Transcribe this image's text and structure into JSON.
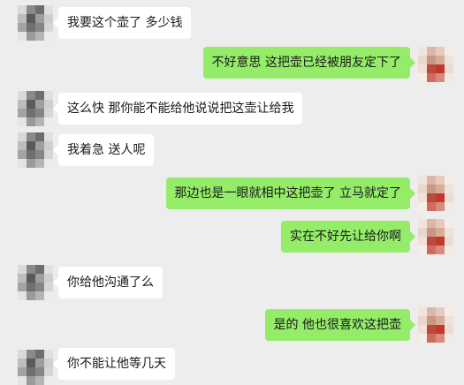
{
  "colors": {
    "background": "#ededed",
    "bubble_self": "#95ec69",
    "bubble_other": "#ffffff",
    "text": "#191919"
  },
  "messages": [
    {
      "side": "left",
      "text": "我要这个壶了 多少钱"
    },
    {
      "side": "right",
      "text": "不好意思  这把壶已经被朋友定下了"
    },
    {
      "side": "left",
      "text": "这么快  那你能不能给他说说把这壶让给我"
    },
    {
      "side": "left",
      "text": "我着急 送人呢"
    },
    {
      "side": "right",
      "text": "那边也是一眼就相中这把壶了 立马就定了"
    },
    {
      "side": "right",
      "text": "实在不好先让给你啊"
    },
    {
      "side": "left",
      "text": "你给他沟通了么"
    },
    {
      "side": "right",
      "text": "是的  他也很喜欢这把壶"
    },
    {
      "side": "left",
      "text": "你不能让他等几天"
    }
  ]
}
